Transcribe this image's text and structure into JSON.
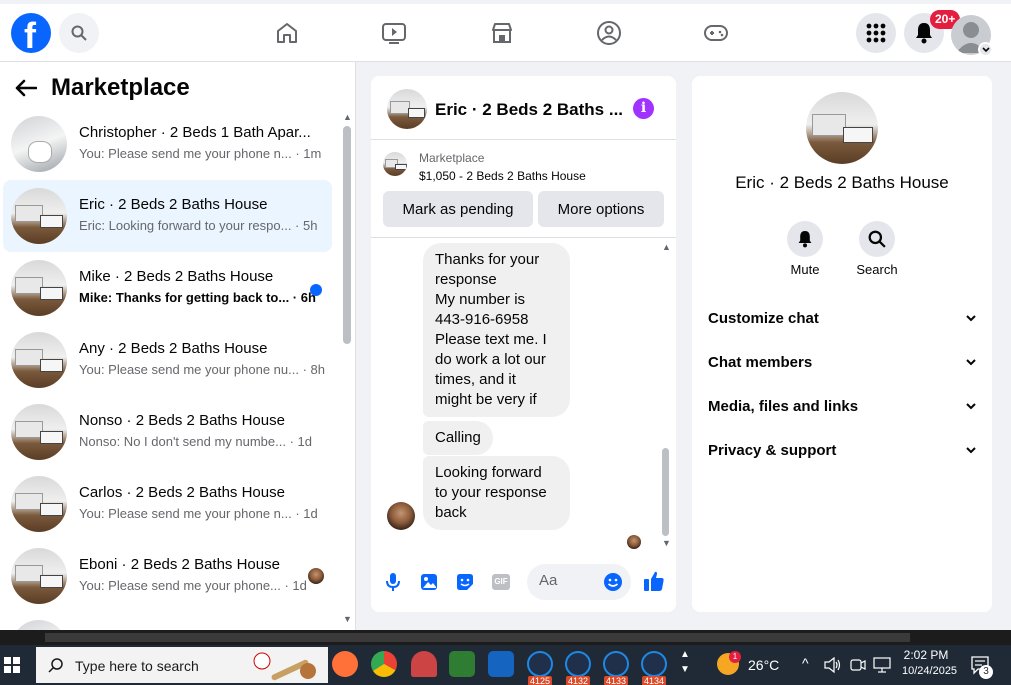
{
  "topnav": {
    "logo_letter": "f",
    "notifications_badge": "20+"
  },
  "left": {
    "title": "Marketplace",
    "conversations": [
      {
        "name": "Christopher · 2 Beds 1 Bath Apar...",
        "snippet": "You: Please send me your phone n... · 1m",
        "unread": false
      },
      {
        "name": "Eric · 2 Beds 2 Baths House",
        "snippet": "Eric: Looking forward to your respo... · 5h",
        "unread": false
      },
      {
        "name": "Mike · 2 Beds 2 Baths House",
        "snippet": "Mike: Thanks for getting back to... · 6h",
        "unread": true
      },
      {
        "name": "Any · 2 Beds 2 Baths House",
        "snippet": "You: Please send me your phone nu... · 8h",
        "unread": false
      },
      {
        "name": "Nonso · 2 Beds 2 Baths House",
        "snippet": "Nonso: No I don't send my numbe... · 1d",
        "unread": false
      },
      {
        "name": "Carlos · 2 Beds 2 Baths House",
        "snippet": "You: Please send me your phone n... · 1d",
        "unread": false
      },
      {
        "name": "Eboni · 2 Beds 2 Baths House",
        "snippet": "You: Please send me your phone... · 1d",
        "unread": false
      }
    ]
  },
  "chat": {
    "title": "Eric · 2 Beds 2 Baths ...",
    "listing_source": "Marketplace",
    "listing_price": "$1,050 - 2 Beds 2 Baths House",
    "mark_pending_label": "Mark as pending",
    "more_options_label": "More options",
    "messages": [
      {
        "lines": [
          "Thanks for your",
          "response",
          "My number is",
          "443-916-6958",
          "Please text me. I",
          "do work a lot our",
          "times, and it",
          "might be very if"
        ]
      },
      {
        "lines": [
          "Calling"
        ]
      },
      {
        "lines": [
          "Looking forward",
          "to your response",
          "back"
        ]
      }
    ],
    "composer_placeholder": "Aa",
    "gif_label": "GIF"
  },
  "right": {
    "name": "Eric · 2 Beds 2 Baths House",
    "mute_label": "Mute",
    "search_label": "Search",
    "sections": [
      "Customize chat",
      "Chat members",
      "Media, files and links",
      "Privacy & support"
    ]
  },
  "taskbar": {
    "search_placeholder": "Type here to search",
    "app_badges": [
      "4125",
      "4132",
      "4133",
      "4134"
    ],
    "weather_badge": "1",
    "temperature": "26°C",
    "time": "2:02 PM",
    "date": "10/24/2025",
    "notification_count": "3"
  },
  "colors": {
    "fb_blue": "#0866ff",
    "badge_red": "#e41e3f",
    "info_purple": "#a033ff"
  }
}
